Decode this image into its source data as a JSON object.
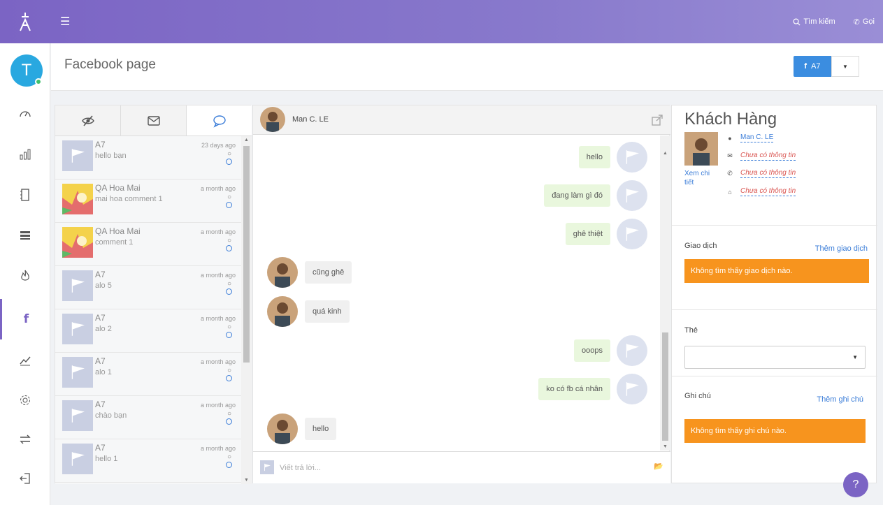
{
  "topbar": {
    "search_label": "Tìm kiếm",
    "call_label": "Gọi",
    "icons": [
      "app-logo-icon",
      "hamburger-icon",
      "search-icon",
      "phone-icon"
    ]
  },
  "sidebar": {
    "avatar_letter": "T",
    "items": [
      {
        "name": "dashboard-icon"
      },
      {
        "name": "reports-icon"
      },
      {
        "name": "contacts-icon"
      },
      {
        "name": "list-icon"
      },
      {
        "name": "fire-icon"
      },
      {
        "name": "facebook-icon",
        "active": true
      },
      {
        "name": "analytics-icon"
      },
      {
        "name": "settings-icon"
      },
      {
        "name": "transfer-icon"
      },
      {
        "name": "logout-icon"
      }
    ]
  },
  "header": {
    "title": "Facebook page",
    "page_button": "A7"
  },
  "conversations": [
    {
      "name": "A7",
      "message": "hello bạn",
      "time": "23 days ago",
      "thumb": "flag"
    },
    {
      "name": "QA Hoa Mai",
      "message": "mai hoa comment 1",
      "time": "a month ago",
      "thumb": "hoa"
    },
    {
      "name": "QA Hoa Mai",
      "message": "comment 1",
      "time": "a month ago",
      "thumb": "hoa"
    },
    {
      "name": "A7",
      "message": "alo 5",
      "time": "a month ago",
      "thumb": "flag"
    },
    {
      "name": "A7",
      "message": "alo 2",
      "time": "a month ago",
      "thumb": "flag"
    },
    {
      "name": "A7",
      "message": "alo 1",
      "time": "a month ago",
      "thumb": "flag"
    },
    {
      "name": "A7",
      "message": "chào bạn",
      "time": "a month ago",
      "thumb": "flag"
    },
    {
      "name": "A7",
      "message": "hello 1",
      "time": "a month ago",
      "thumb": "flag"
    }
  ],
  "chat": {
    "contact_name": "Man C. LE",
    "messages": [
      {
        "text": "hello",
        "dir": "out"
      },
      {
        "text": "đang làm gì đó",
        "dir": "out"
      },
      {
        "text": "ghê thiệt",
        "dir": "out"
      },
      {
        "text": "cũng ghê",
        "dir": "in"
      },
      {
        "text": "quá kinh",
        "dir": "in"
      },
      {
        "text": "ooops",
        "dir": "out"
      },
      {
        "text": "ko có fb cá nhân",
        "dir": "out"
      },
      {
        "text": "hello",
        "dir": "in"
      }
    ],
    "reply_placeholder": "Viết trả lời..."
  },
  "customer": {
    "title": "Khách Hàng",
    "view_details": "Xem chi tiết",
    "name": "Man C. LE",
    "email": "Chưa có thông tin",
    "phone": "Chưa có thông tin",
    "address": "Chưa có thông tin",
    "transactions_label": "Giao dịch",
    "add_transaction": "Thêm giao dịch",
    "no_transactions": "Không tìm thấy giao dịch nào.",
    "tags_label": "Thẻ",
    "notes_label": "Ghi chú",
    "add_note": "Thêm ghi chú",
    "no_notes": "Không tìm thấy ghi chú nào."
  },
  "colors": {
    "accent": "#7b64c4",
    "link": "#3b7dd8",
    "warning": "#f7941e",
    "facebook_button": "#3b8de0"
  }
}
